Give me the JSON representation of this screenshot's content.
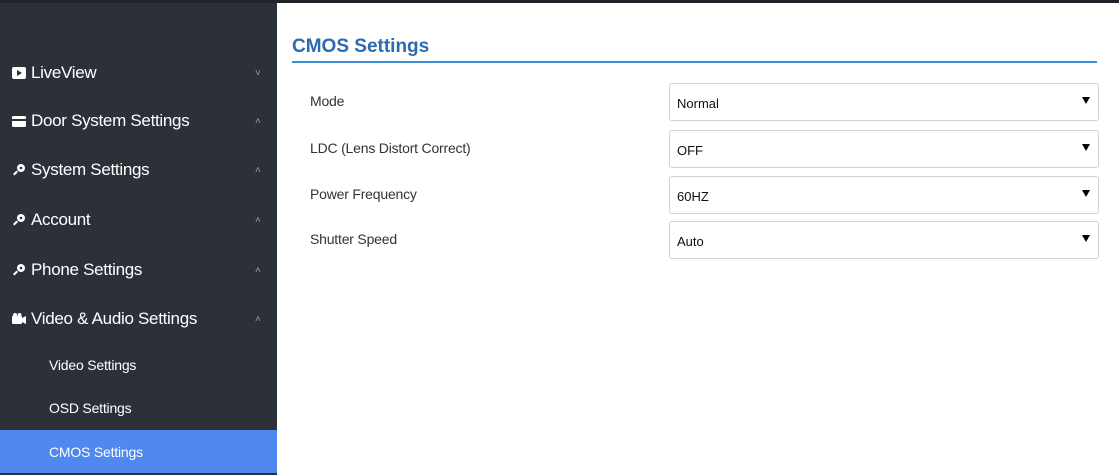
{
  "sidebar": {
    "items": [
      {
        "label": "LiveView",
        "icon": "video-icon",
        "chevron": "˅"
      },
      {
        "label": "Door System Settings",
        "icon": "card-icon",
        "chevron": "˄"
      },
      {
        "label": "System Settings",
        "icon": "key-icon",
        "chevron": "˄"
      },
      {
        "label": "Account",
        "icon": "key-icon",
        "chevron": "˄"
      },
      {
        "label": "Phone Settings",
        "icon": "key-icon",
        "chevron": "˄"
      },
      {
        "label": "Video & Audio Settings",
        "icon": "camera-icon",
        "chevron": "˄"
      }
    ],
    "subitems": [
      {
        "label": "Video Settings"
      },
      {
        "label": "OSD Settings"
      },
      {
        "label": "CMOS Settings",
        "active": true
      }
    ],
    "active_color": "#4f88ee"
  },
  "main": {
    "title": "CMOS Settings",
    "fields": [
      {
        "label": "Mode",
        "value": "Normal"
      },
      {
        "label": "LDC (Lens Distort Correct)",
        "value": "OFF"
      },
      {
        "label": "Power Frequency",
        "value": "60HZ"
      },
      {
        "label": "Shutter Speed",
        "value": "Auto"
      }
    ]
  },
  "colors": {
    "sidebar_bg": "#2c3039",
    "title": "#2c6ab2",
    "accent_rule": "#3a8fd6"
  }
}
